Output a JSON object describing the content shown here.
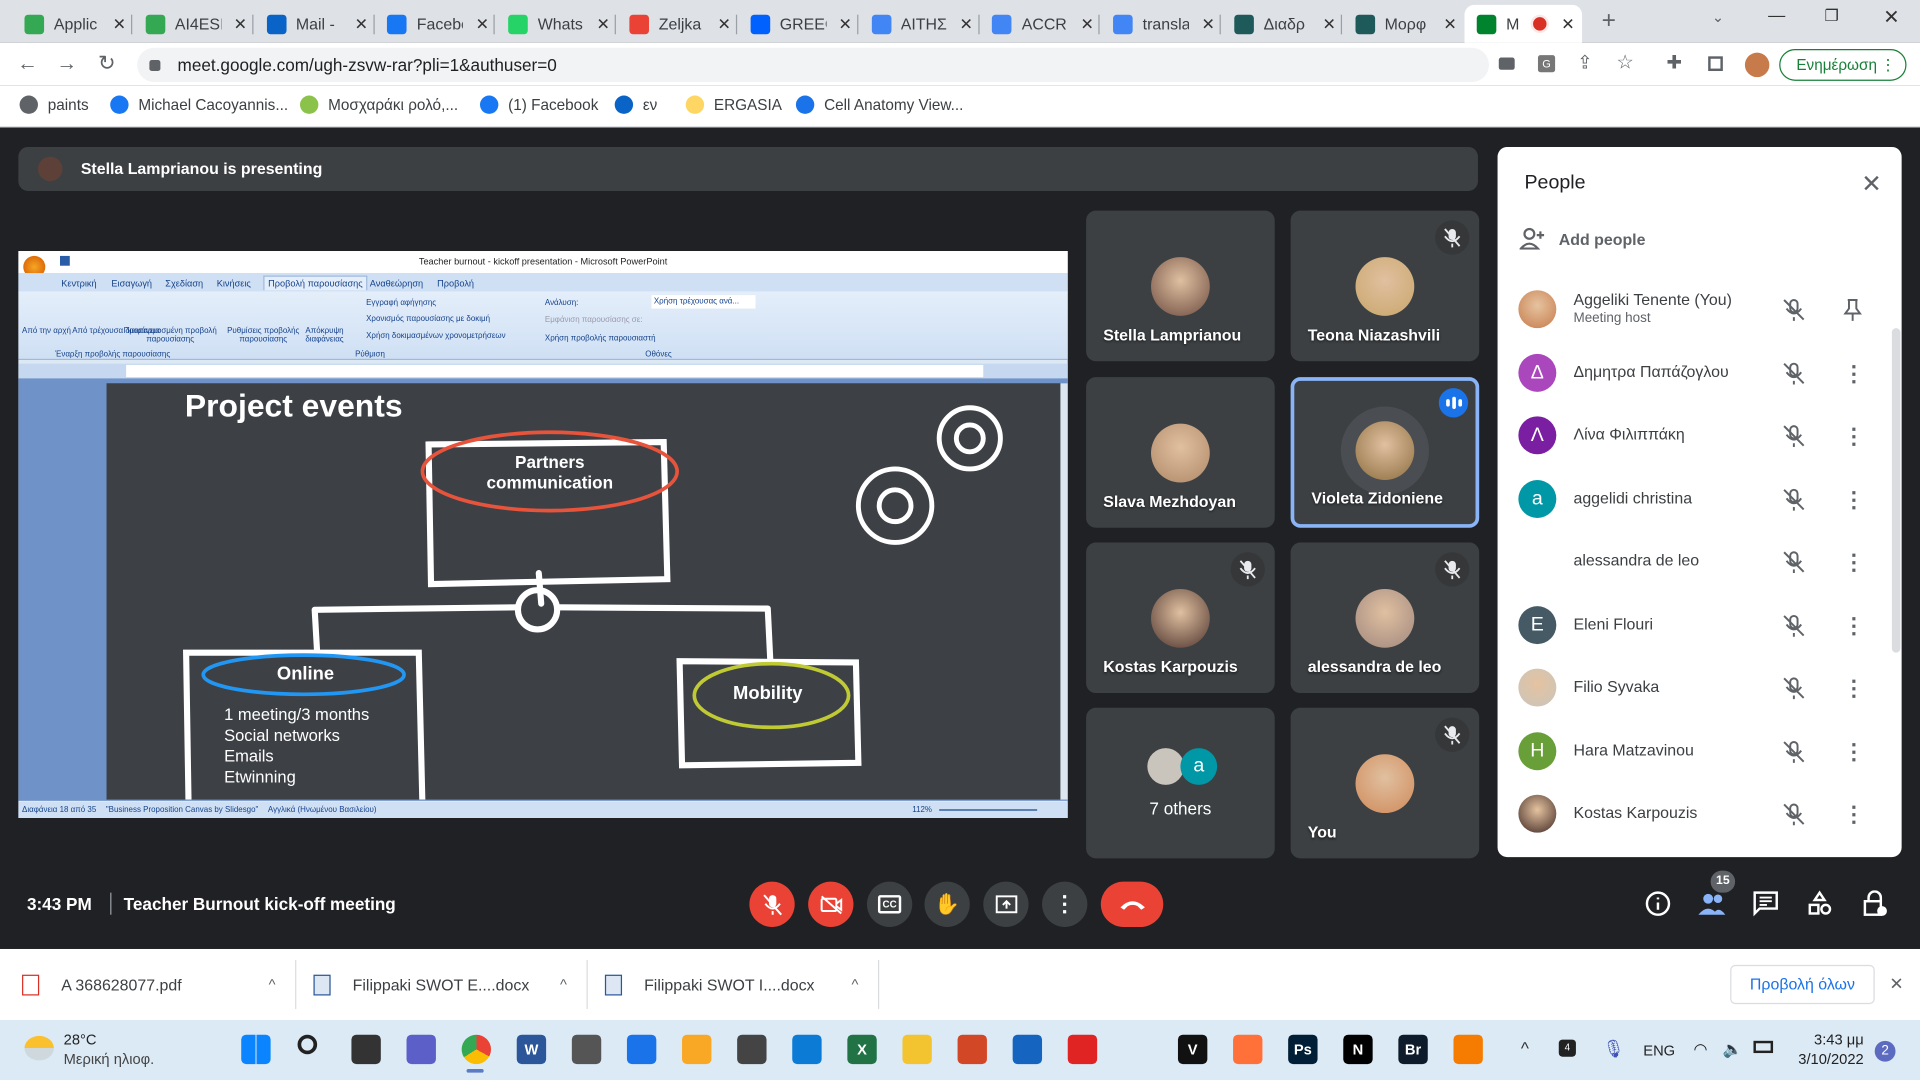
{
  "browser": {
    "tabs": [
      {
        "title": "Applic",
        "icon": "google-drive-icon",
        "color": "#34a853"
      },
      {
        "title": "AI4ESL",
        "icon": "google-drive-icon",
        "color": "#34a853"
      },
      {
        "title": "Mail -",
        "icon": "outlook-icon",
        "color": "#0a64c8"
      },
      {
        "title": "Facebo",
        "icon": "facebook-icon",
        "color": "#1877f2"
      },
      {
        "title": "Whats",
        "icon": "whatsapp-icon",
        "color": "#25d366"
      },
      {
        "title": "Zeljka",
        "icon": "gmail-icon",
        "color": "#ea4335"
      },
      {
        "title": "GREEC",
        "icon": "dropbox-icon",
        "color": "#0061fe"
      },
      {
        "title": "ΑΙΤΗΣΙ",
        "icon": "google-docs-icon",
        "color": "#4285f4"
      },
      {
        "title": "ACCRE",
        "icon": "google-docs-icon",
        "color": "#4285f4"
      },
      {
        "title": "transla",
        "icon": "google-icon",
        "color": "#4285f4"
      },
      {
        "title": "Διαδρ",
        "icon": "site-icon",
        "color": "#1e5a5a"
      },
      {
        "title": "Μορφ",
        "icon": "site-icon",
        "color": "#1e5a5a"
      },
      {
        "title": "M",
        "icon": "google-meet-icon",
        "color": "#00832d",
        "active": true,
        "recording": true
      }
    ],
    "url": "meet.google.com/ugh-zsvw-rar?pli=1&authuser=0",
    "update_label": "Ενημέρωση",
    "bookmarks": [
      {
        "label": "paints",
        "icon": "globe-icon",
        "color": "#5f6368"
      },
      {
        "label": "Michael Cacoyannis...",
        "icon": "facebook-icon",
        "color": "#1877f2"
      },
      {
        "label": "Μοσχαράκι ρολό,...",
        "icon": "recipe-icon",
        "color": "#8bc34a"
      },
      {
        "label": "(1) Facebook",
        "icon": "facebook-icon",
        "color": "#1877f2"
      },
      {
        "label": "εν",
        "icon": "outlook-icon",
        "color": "#0a64c8"
      },
      {
        "label": "ERGASIA",
        "icon": "folder-icon",
        "color": "#fdd663"
      },
      {
        "label": "Cell Anatomy View...",
        "icon": "cell-icon",
        "color": "#1a73e8"
      }
    ]
  },
  "meet": {
    "presenting_text": "Stella Lamprianou is presenting",
    "tiles": [
      {
        "name": "Stella Lamprianou",
        "muted": false,
        "color": "#6d4c41"
      },
      {
        "name": "Teona Niazashvili",
        "muted": true,
        "color": "#c9a66b"
      },
      {
        "name": "Slava Mezhdoyan",
        "muted": false,
        "color": "#b08968"
      },
      {
        "name": "Violeta Zidoniene",
        "muted": false,
        "speaking": true,
        "color": "#8d6e3f"
      },
      {
        "name": "Kostas Karpouzis",
        "muted": true,
        "color": "#4e342e"
      },
      {
        "name": "alessandra de leo",
        "muted": true,
        "color": "#a1887f"
      },
      {
        "name": "7 others",
        "muted": false,
        "others": true
      },
      {
        "name": "You",
        "muted": true,
        "color": "#d08a5a"
      }
    ],
    "others_avatar_letter": "a",
    "people_panel": {
      "title": "People",
      "add_people": "Add people",
      "participants": [
        {
          "name": "Aggeliki Tenente (You)",
          "role": "Meeting host",
          "photo": true,
          "color": "#c77b4a",
          "action": "pin-icon"
        },
        {
          "name": "Δημητρα Παπάζογλου",
          "letter": "Δ",
          "color": "#ab47bc",
          "action": "more-icon"
        },
        {
          "name": "Λίνα Φιλιππάκη",
          "letter": "Λ",
          "color": "#7b1fa2",
          "action": "more-icon"
        },
        {
          "name": "aggelidi christina",
          "letter": "a",
          "color": "#0097a7",
          "action": "more-icon"
        },
        {
          "name": "alessandra de leo",
          "letter": "",
          "color": "#ffffff",
          "action": "more-icon"
        },
        {
          "name": "Eleni Flouri",
          "letter": "E",
          "color": "#455a64",
          "action": "more-icon"
        },
        {
          "name": "Filio Syvaka",
          "photo": true,
          "color": "#c9c4bc",
          "action": "more-icon"
        },
        {
          "name": "Hara Matzavinou",
          "letter": "H",
          "color": "#689f38",
          "action": "more-icon"
        },
        {
          "name": "Kostas Karpouzis",
          "photo": true,
          "color": "#3e2723",
          "action": "more-icon"
        }
      ]
    },
    "time": "3:43 PM",
    "meeting_title": "Teacher Burnout kick-off meeting",
    "participant_count": "15",
    "controls": [
      "mic-off-icon",
      "camera-off-icon",
      "captions-icon",
      "raise-hand-icon",
      "present-icon",
      "more-icon",
      "end-call-icon"
    ],
    "right_controls": [
      "info-icon",
      "people-icon",
      "chat-icon",
      "activities-icon",
      "host-controls-icon"
    ]
  },
  "powerpoint": {
    "window_title": "Teacher burnout - kickoff presentation - Microsoft PowerPoint",
    "ribbon_tabs": [
      "Κεντρική",
      "Εισαγωγή",
      "Σχεδίαση",
      "Κινήσεις",
      "Προβολή παρουσίασης",
      "Αναθεώρηση",
      "Προβολή"
    ],
    "active_tab": "Προβολή παρουσίασης",
    "ribbon": {
      "from_start": "Από την αρχή",
      "from_current": "Από τρέχουσα διαφάνεια",
      "custom_show": "Προσαρμοσμένη προβολή παρουσίασης",
      "group1": "Έναρξη προβολής παρουσίασης",
      "setup_show": "Ρυθμίσεις προβολής παρουσίασης",
      "hide_slide": "Απόκρυψη διαφάνειας",
      "record_narration": "Εγγραφή αφήγησης",
      "rehearse": "Χρονισμός παρουσίασης με δοκιμή",
      "use_timings": "Χρήση δοκιμασμένων χρονομετρήσεων",
      "group2": "Ρύθμιση",
      "resolution_label": "Ανάλυση:",
      "resolution_value": "Χρήση τρέχουσας ανά...",
      "show_on": "Εμφάνιση παρουσίασης σε:",
      "presenter_view": "Χρήση προβολής παρουσιαστή",
      "group3": "Οθόνες"
    },
    "status": {
      "slide": "Διαφάνεια 18 από 35",
      "theme": "\"Business Proposition Canvas by Slidesgo\"",
      "language": "Αγγλικά (Ηνωμένου Βασιλείου)",
      "zoom": "112%"
    },
    "slide": {
      "title": "Project events",
      "box_top": "Partners communication",
      "box_left": "Online",
      "box_right": "Mobility",
      "bullets": [
        "1 meeting/3 months",
        "Social networks",
        "Emails",
        "Etwinning"
      ]
    }
  },
  "downloads": {
    "items": [
      {
        "name": "A 368628077.pdf",
        "icon": "pdf-icon"
      },
      {
        "name": "Filippaki SWOT E....docx",
        "icon": "word-doc-icon"
      },
      {
        "name": "Filippaki SWOT I....docx",
        "icon": "word-doc-icon"
      }
    ],
    "show_all": "Προβολή όλων"
  },
  "taskbar": {
    "weather_temp": "28°C",
    "weather_desc": "Μερική ηλιοφ.",
    "apps": [
      {
        "name": "start",
        "color": "#0078d4",
        "label": ""
      },
      {
        "name": "search",
        "color": "transparent",
        "label": ""
      },
      {
        "name": "task-view",
        "color": "#333",
        "label": ""
      },
      {
        "name": "teams-chat",
        "color": "#5b5fc7",
        "label": ""
      },
      {
        "name": "chrome",
        "color": "#4285f4",
        "label": ""
      },
      {
        "name": "word",
        "color": "#2b579a",
        "label": "W"
      },
      {
        "name": "calculator",
        "color": "#555",
        "label": ""
      },
      {
        "name": "calendar",
        "color": "#1a73e8",
        "label": ""
      },
      {
        "name": "weather",
        "color": "#f9a825",
        "label": ""
      },
      {
        "name": "camera",
        "color": "#444",
        "label": ""
      },
      {
        "name": "edge",
        "color": "#0c7bd6",
        "label": ""
      },
      {
        "name": "excel",
        "color": "#217346",
        "label": "X"
      },
      {
        "name": "file-explorer",
        "color": "#f4c430",
        "label": ""
      },
      {
        "name": "powerpoint",
        "color": "#d24726",
        "label": ""
      },
      {
        "name": "whiteboard",
        "color": "#1565c0",
        "label": ""
      },
      {
        "name": "acrobat",
        "color": "#e02424",
        "label": ""
      },
      {
        "name": "vegas",
        "color": "#111",
        "label": "V"
      },
      {
        "name": "firefox",
        "color": "#ff7139",
        "label": ""
      },
      {
        "name": "photoshop",
        "color": "#001e36",
        "label": "Ps"
      },
      {
        "name": "netflix",
        "color": "#000",
        "label": "N"
      },
      {
        "name": "bridge",
        "color": "#0d1b2a",
        "label": "Br"
      },
      {
        "name": "vlc",
        "color": "#f57c00",
        "label": ""
      }
    ],
    "language": "ENG",
    "clock_time": "3:43 μμ",
    "clock_date": "3/10/2022",
    "notifications": "2",
    "tray_badge": "4"
  }
}
